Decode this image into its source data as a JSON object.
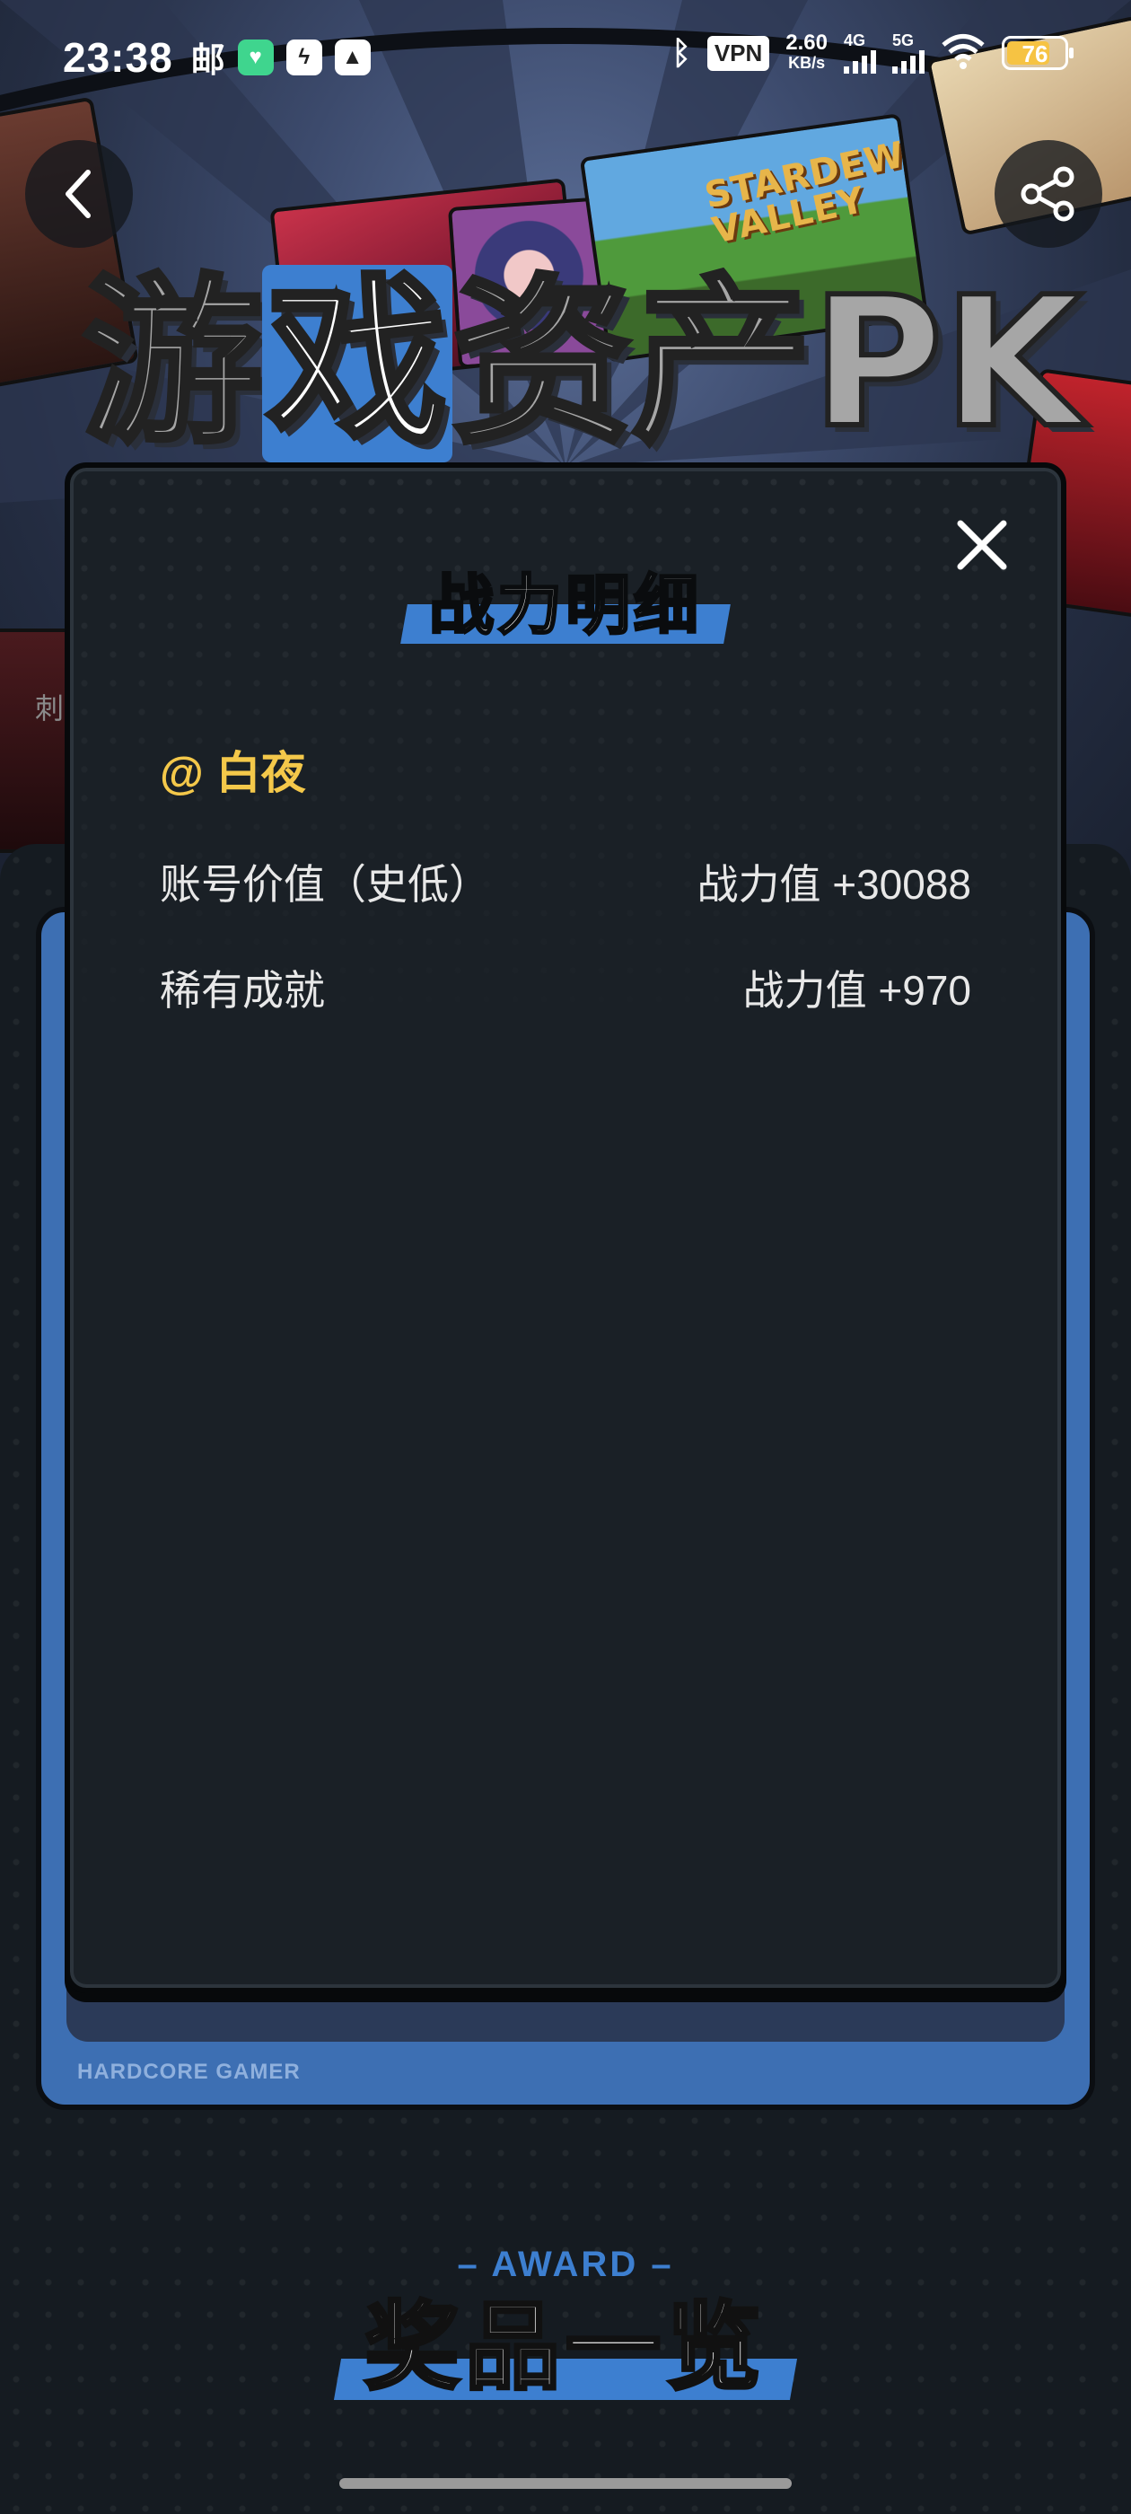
{
  "status_bar": {
    "time": "23:38",
    "mail_glyph": "邮",
    "vpn": "VPN",
    "speed_value": "2.60",
    "speed_unit": "KB/s",
    "signal_1": "4G",
    "signal_2": "5G",
    "battery": "76"
  },
  "hero": {
    "title_parts": [
      "游",
      "戏",
      "资产PK"
    ],
    "cover_text": "STARDEW VALLEY",
    "side_text": "刺"
  },
  "modal": {
    "title": "战力明细",
    "user": "@ 白夜",
    "rows": [
      {
        "label": "账号价值（史低）",
        "value": "战力值 +30088"
      },
      {
        "label": "稀有成就",
        "value": "战力值 +970"
      }
    ]
  },
  "card": {
    "footer": "HARDCORE GAMER"
  },
  "award": {
    "en": "– AWARD –",
    "cn": "奖品一览"
  },
  "colors": {
    "accent_blue": "#3d7fd0",
    "gold": "#f4c84a",
    "battery": "#f6c343"
  },
  "icons": [
    "back-arrow-icon",
    "share-icon",
    "close-icon",
    "bluetooth-icon",
    "wifi-icon"
  ]
}
